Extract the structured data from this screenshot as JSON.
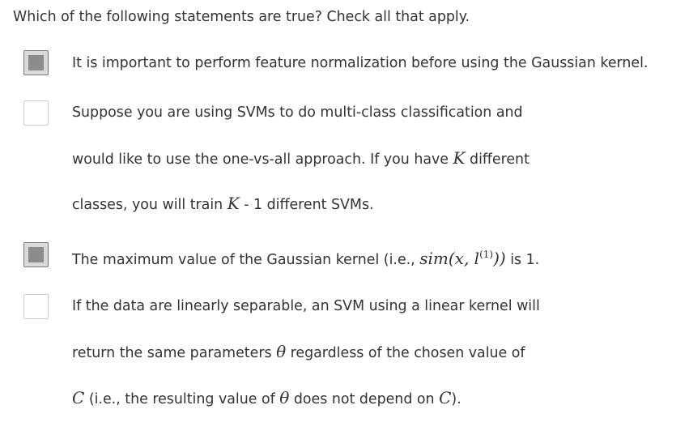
{
  "question": {
    "prompt": "Which of the following statements are true? Check all that apply."
  },
  "options": [
    {
      "checked": true,
      "text": "It is important to perform feature normalization before using the Gaussian kernel."
    },
    {
      "checked": false,
      "line1": "Suppose you are using SVMs to do multi-class classification and",
      "line2_a": "would like to use the one-vs-all approach. If you have ",
      "line2_math": "K",
      "line2_b": " different",
      "line3_a": "classes, you will train ",
      "line3_math": "K",
      "line3_b": " - 1 different SVMs."
    },
    {
      "checked": true,
      "text_a": "The maximum value of the Gaussian kernel (i.e., ",
      "math": "sim(x, l",
      "math_sup": "(1)",
      "math_close": "))",
      "text_b": " is 1."
    },
    {
      "checked": false,
      "line1": "If the data are linearly separable, an SVM using a linear kernel will",
      "line2_a": "return the same parameters ",
      "line2_math": "θ",
      "line2_b": " regardless of the chosen value of",
      "line3_math1": "C",
      "line3_a": " (i.e., the resulting value of ",
      "line3_math2": "θ",
      "line3_b": " does not depend on ",
      "line3_math3": "C",
      "line3_c": ")."
    }
  ]
}
